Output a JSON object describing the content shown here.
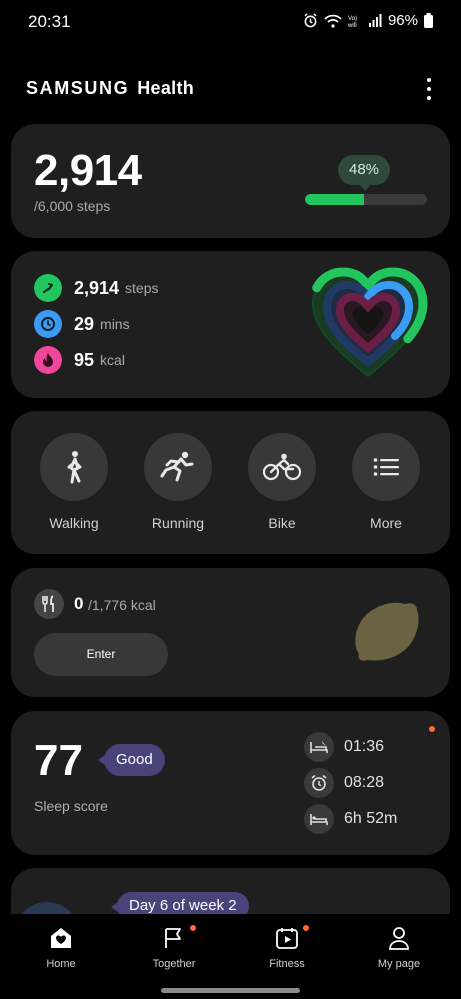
{
  "status_bar": {
    "time": "20:31",
    "battery": "96%",
    "icons": [
      "alarm-icon",
      "wifi-icon",
      "volte-wifi-icon",
      "signal-icon",
      "battery-icon"
    ]
  },
  "header": {
    "brand": "SAMSUNG",
    "app": "Health",
    "menu_icon": "more-vertical-icon"
  },
  "steps_card": {
    "steps": "2,914",
    "goal_text": "/6,000 steps",
    "percent_text": "48%",
    "progress_fraction": 0.48,
    "accent": "#22c55e"
  },
  "activity_card": {
    "rows": [
      {
        "icon": "steps-icon",
        "color": "#22c55e",
        "value": "2,914",
        "unit": "steps"
      },
      {
        "icon": "clock-icon",
        "color": "#3b9cf4",
        "value": "29",
        "unit": "mins"
      },
      {
        "icon": "flame-icon",
        "color": "#f0479a",
        "value": "95",
        "unit": "kcal"
      }
    ]
  },
  "workouts": [
    {
      "label": "Walking",
      "icon": "walking-icon"
    },
    {
      "label": "Running",
      "icon": "running-icon"
    },
    {
      "label": "Bike",
      "icon": "bike-icon"
    },
    {
      "label": "More",
      "icon": "list-icon"
    }
  ],
  "food_card": {
    "value": "0",
    "goal": "/1,776 kcal",
    "button": "Enter",
    "icon": "fork-knife-icon"
  },
  "sleep_card": {
    "score": "77",
    "badge": "Good",
    "label": "Sleep score",
    "rows": [
      {
        "icon": "bedtime-icon",
        "value": "01:36"
      },
      {
        "icon": "alarm-clock-icon",
        "value": "08:28"
      },
      {
        "icon": "sleep-duration-icon",
        "value": "6h 52m"
      }
    ]
  },
  "program_card": {
    "badge": "Day 6 of week 2"
  },
  "bottom_nav": [
    {
      "label": "Home",
      "icon": "home-icon",
      "dot": false
    },
    {
      "label": "Together",
      "icon": "flag-icon",
      "dot": true
    },
    {
      "label": "Fitness",
      "icon": "fitness-calendar-icon",
      "dot": true
    },
    {
      "label": "My page",
      "icon": "person-icon",
      "dot": false
    }
  ]
}
